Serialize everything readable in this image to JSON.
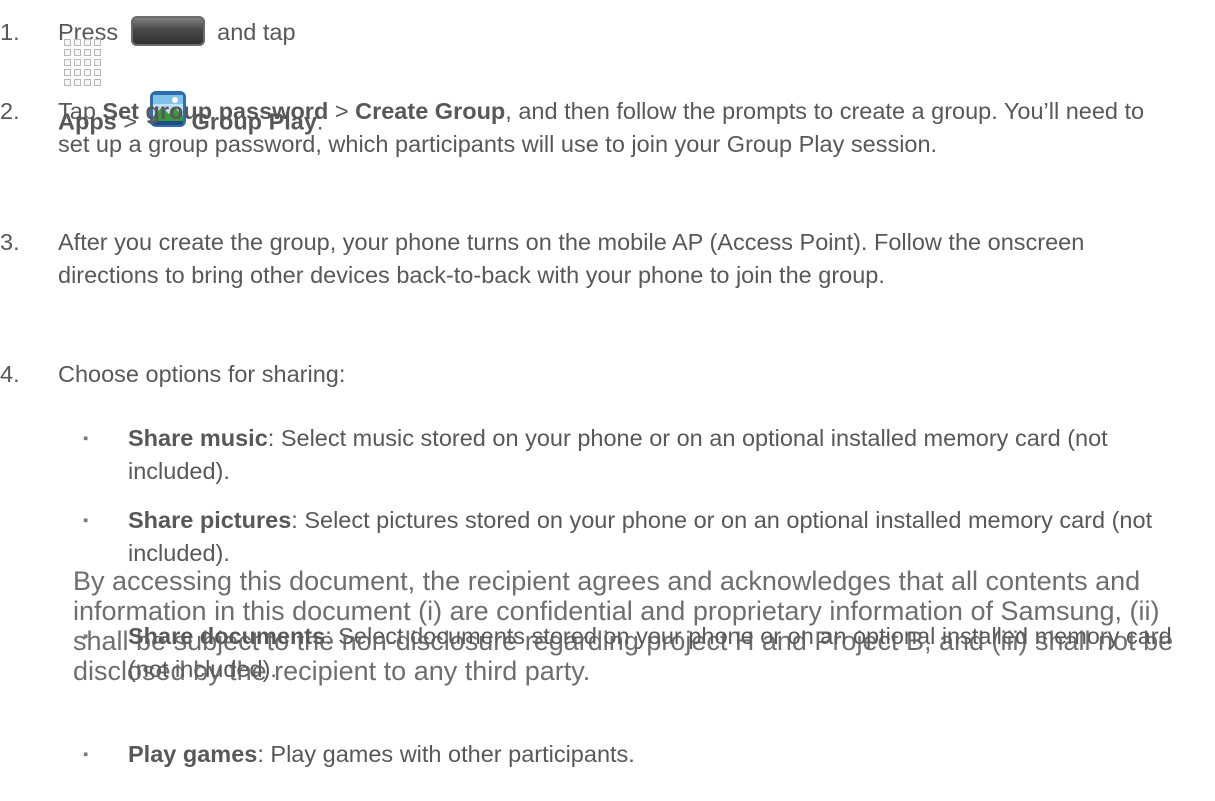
{
  "steps": [
    {
      "num": "1.",
      "before": "Press",
      "and_tap": "and tap",
      "apps": "Apps",
      "sep": ">",
      "group_play": "Group Play",
      "end": "."
    },
    {
      "num": "2.",
      "before": "Tap ",
      "bold1": "Set group password",
      "sep": " > ",
      "bold2": "Create Group",
      "after": ", and then follow the prompts to create a group. You’ll need to set up a group password, which participants will use to join your Group Play session."
    },
    {
      "num": "3.",
      "text": "After you create the group, your phone turns on the mobile AP (Access Point). Follow the onscreen directions to bring other devices back-to-back with your phone to join the group."
    },
    {
      "num": "4.",
      "text": "Choose options for sharing:"
    }
  ],
  "bullets": [
    {
      "marker": "▪",
      "label": "Share music",
      "text": ": Select music stored on your phone or on an optional installed memory card (not included)."
    },
    {
      "marker": "▪",
      "label": "Share pictures",
      "text": ": Select pictures stored on your phone or on an optional installed memory card (not included)."
    },
    {
      "marker": "▪",
      "label": "Share documents",
      "text": ": Select documents stored on your phone or on an optional installed memory card (not included)."
    },
    {
      "marker": "▪",
      "label": "Play games",
      "text": ": Play games with other participants."
    }
  ],
  "icons": {
    "home_key": "home-key-icon",
    "apps": "apps-grid-icon",
    "group_play": "group-play-app-icon"
  },
  "watermark": "By accessing this document, the recipient agrees and acknowledges that all contents and information in this document (i) are confidential and proprietary information of Samsung, (ii) shall be subject to the non-disclosure regarding project H and Project B, and (iii) shall not be disclosed by the recipient to any third party."
}
